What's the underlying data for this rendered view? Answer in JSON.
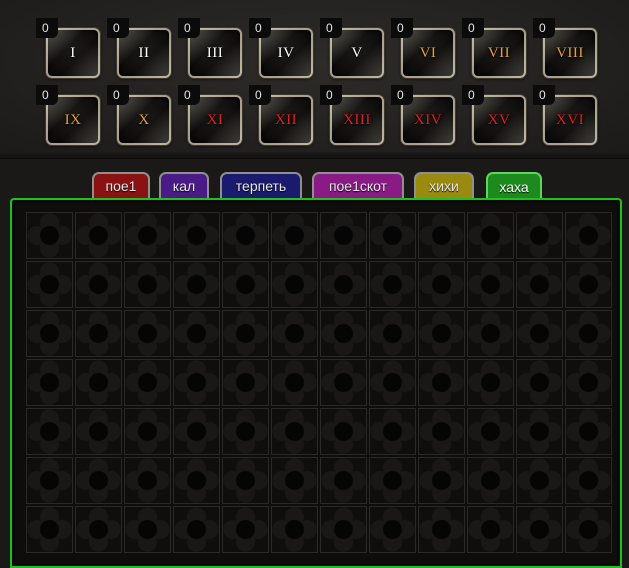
{
  "slots": [
    {
      "count": "0",
      "label": "I",
      "color": "#ffffff"
    },
    {
      "count": "0",
      "label": "II",
      "color": "#ffffff"
    },
    {
      "count": "0",
      "label": "III",
      "color": "#ffffff"
    },
    {
      "count": "0",
      "label": "IV",
      "color": "#ffffff"
    },
    {
      "count": "0",
      "label": "V",
      "color": "#ffffff"
    },
    {
      "count": "0",
      "label": "VI",
      "color": "#e8a23a"
    },
    {
      "count": "0",
      "label": "VII",
      "color": "#e8a23a"
    },
    {
      "count": "0",
      "label": "VIII",
      "color": "#e8a23a"
    },
    {
      "count": "0",
      "label": "IX",
      "color": "#e8a23a"
    },
    {
      "count": "0",
      "label": "X",
      "color": "#e8a23a"
    },
    {
      "count": "0",
      "label": "XI",
      "color": "#e02020"
    },
    {
      "count": "0",
      "label": "XII",
      "color": "#e02020"
    },
    {
      "count": "0",
      "label": "XIII",
      "color": "#e02020"
    },
    {
      "count": "0",
      "label": "XIV",
      "color": "#e02020"
    },
    {
      "count": "0",
      "label": "XV",
      "color": "#e02020"
    },
    {
      "count": "0",
      "label": "XVI",
      "color": "#e02020"
    }
  ],
  "tabs": [
    {
      "label": "пое1",
      "bg": "#8a1212",
      "active": false
    },
    {
      "label": "кал",
      "bg": "#4a1a86",
      "active": false
    },
    {
      "label": "терпеть",
      "bg": "#1a1a6e",
      "active": false
    },
    {
      "label": "пое1скот",
      "bg": "#8a1a86",
      "active": false
    },
    {
      "label": "хихи",
      "bg": "#9a8a10",
      "active": false
    },
    {
      "label": "хаха",
      "bg": "#1c8a1c",
      "active": true
    }
  ],
  "stash": {
    "columns": 12,
    "rows": 7,
    "border_color": "#1ec21e"
  }
}
